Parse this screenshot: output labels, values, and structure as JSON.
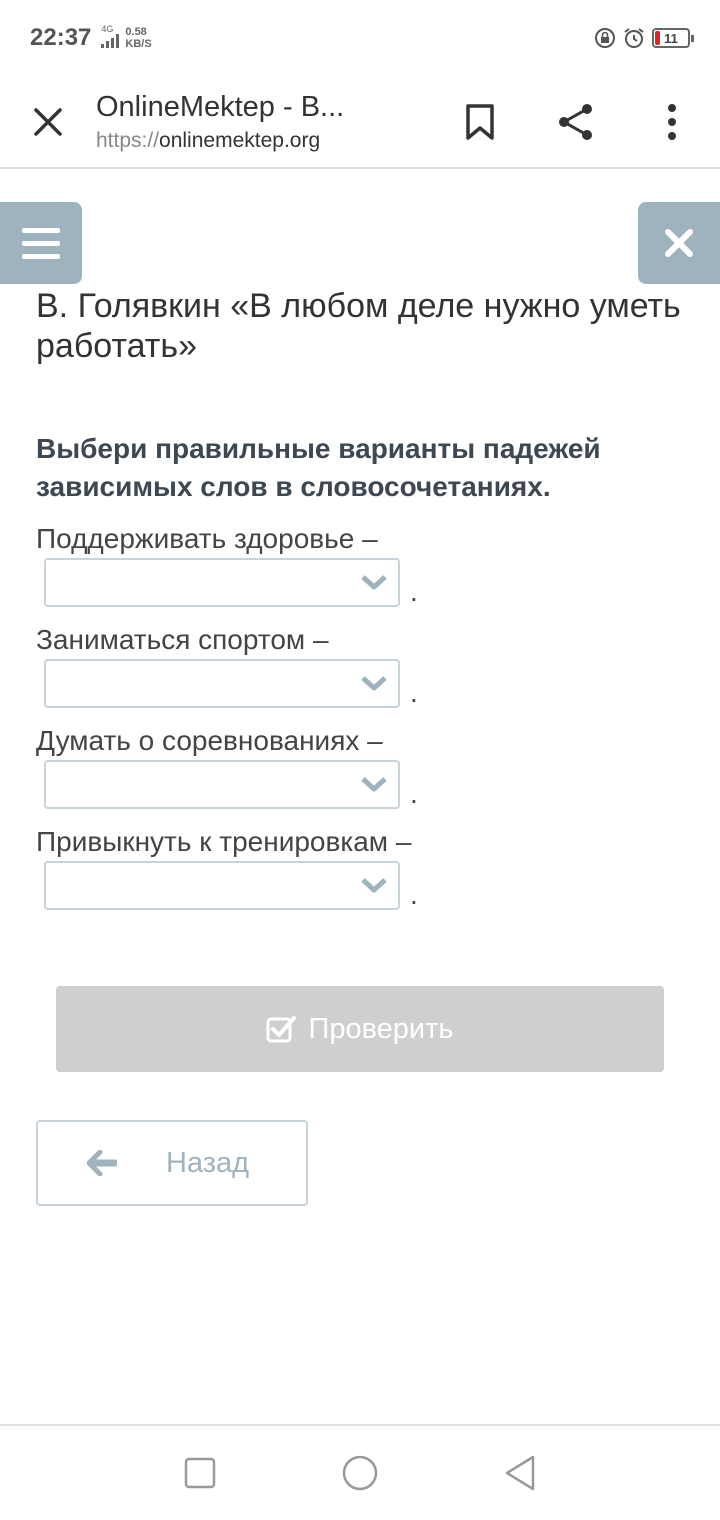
{
  "status": {
    "time": "22:37",
    "network": "4G",
    "speed_value": "0.58",
    "speed_unit": "KB/S",
    "battery": "11"
  },
  "browser": {
    "page_title": "OnlineMektep - В...",
    "url_protocol": "https://",
    "url_domain": "onlinemektep.org"
  },
  "lesson": {
    "title": "В. Голявкин «В любом деле нужно уметь работать»",
    "task": "Выбери правильные варианты падежей зависимых слов в словосочетаниях.",
    "items": [
      {
        "label": "Поддерживать здоровье –",
        "selected": "",
        "end": "."
      },
      {
        "label": "Заниматься спортом –",
        "selected": "",
        "end": "."
      },
      {
        "label": "Думать о соревнованиях –",
        "selected": "",
        "end": "."
      },
      {
        "label": "Привыкнуть к тренировкам –",
        "selected": "",
        "end": "."
      }
    ]
  },
  "actions": {
    "check_label": "Проверить",
    "back_label": "Назад"
  },
  "icons": {
    "close_tab": "close-icon",
    "bookmark": "bookmark-icon",
    "share": "share-icon",
    "more": "more-vertical-icon",
    "menu": "hamburger-menu-icon",
    "exit": "close-icon",
    "dropdown": "chevron-down-icon",
    "check": "checkbox-check-icon",
    "back": "arrow-left-icon"
  },
  "colors": {
    "accent": "#9fb3bf",
    "disabled_button": "#cfcfcf",
    "battery_low": "#e02424"
  }
}
